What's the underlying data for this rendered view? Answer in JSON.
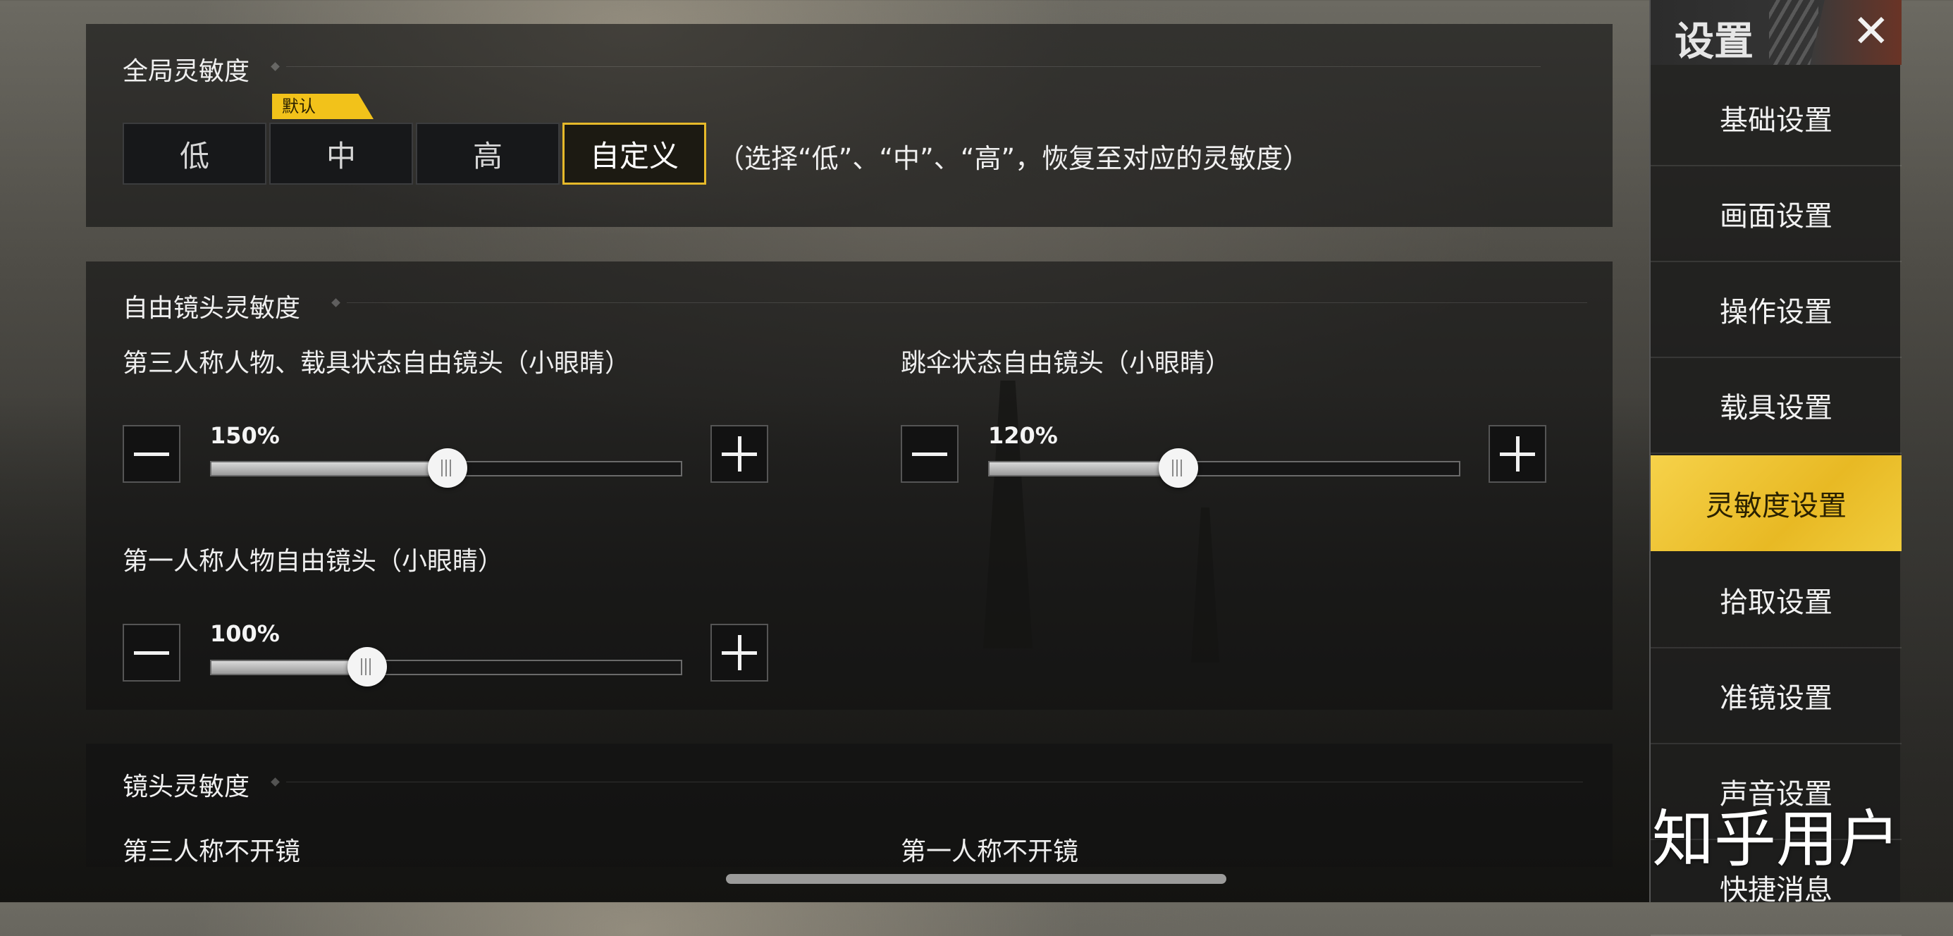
{
  "global_sensitivity": {
    "title": "全局灵敏度",
    "default_tag": "默认",
    "options": [
      "低",
      "中",
      "高",
      "自定义"
    ],
    "selected": "自定义",
    "hint": "（选择“低”、“中”、“高”，恢复至对应的灵敏度）"
  },
  "free_camera": {
    "title": "自由镜头灵敏度",
    "sliders": [
      {
        "label": "第三人称人物、载具状态自由镜头（小眼睛）",
        "value_text": "150%",
        "fraction": 0.5
      },
      {
        "label": "跳伞状态自由镜头（小眼睛）",
        "value_text": "120%",
        "fraction": 0.4
      },
      {
        "label": "第一人称人物自由镜头（小眼睛）",
        "value_text": "100%",
        "fraction": 0.33
      }
    ]
  },
  "scope_sensitivity": {
    "title": "镜头灵敏度",
    "labels": [
      "第三人称不开镜",
      "第一人称不开镜"
    ]
  },
  "menu": {
    "title": "设置",
    "close_icon": "close-icon",
    "items": [
      "基础设置",
      "画面设置",
      "操作设置",
      "载具设置",
      "灵敏度设置",
      "拾取设置",
      "准镜设置",
      "声音设置",
      "快捷消息"
    ],
    "active": "灵敏度设置"
  },
  "watermark": "知乎用户",
  "colors": {
    "accent": "#e6b92a",
    "active_menu": "#f0c832"
  }
}
